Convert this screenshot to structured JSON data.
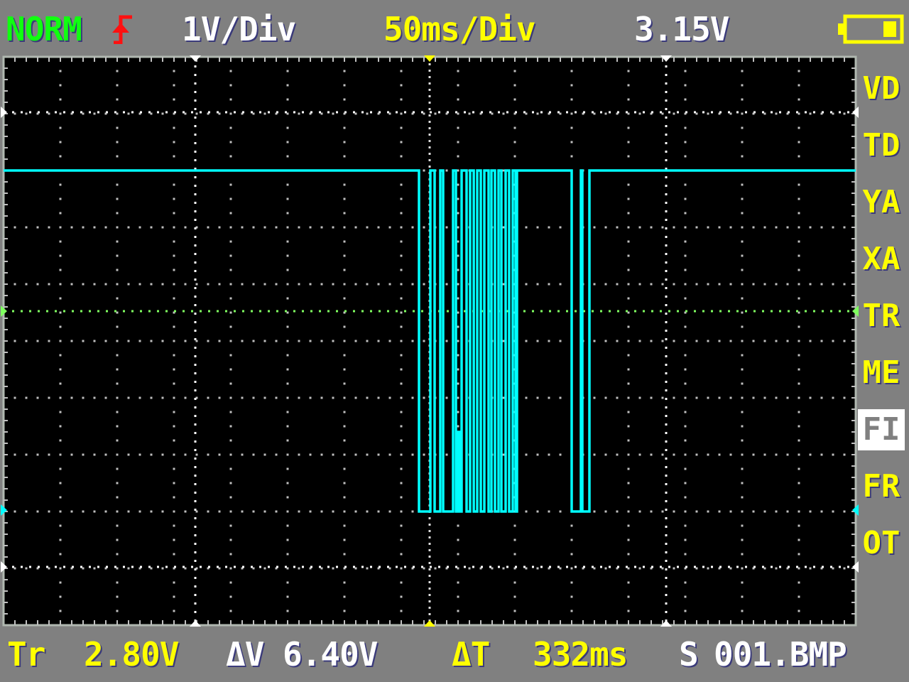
{
  "header": {
    "mode": "NORM",
    "trigger_edge_icon": "rising-edge-icon",
    "volts_per_div": "1V/Div",
    "time_per_div": "50ms/Div",
    "measured_voltage": "3.15V",
    "battery_icon": "battery-icon"
  },
  "menu": [
    {
      "label": "VD",
      "selected": false
    },
    {
      "label": "TD",
      "selected": false
    },
    {
      "label": "YA",
      "selected": false
    },
    {
      "label": "XA",
      "selected": false
    },
    {
      "label": "TR",
      "selected": false
    },
    {
      "label": "ME",
      "selected": false
    },
    {
      "label": "FI",
      "selected": true
    },
    {
      "label": "FR",
      "selected": false
    },
    {
      "label": "OT",
      "selected": false
    }
  ],
  "footer": {
    "trigger_label": "Tr",
    "trigger_value": "2.80V",
    "delta_v_label": "ΔV",
    "delta_v_value": "6.40V",
    "delta_t_label": "ΔT",
    "delta_t_value": "332ms",
    "save_label": "S",
    "save_file": "001.BMP"
  },
  "colors": {
    "trace": "#00ffff",
    "trigger_level": "#80ff60",
    "grid": "#c0c0c0",
    "background": "#808080",
    "screen": "#000000"
  },
  "chart_data": {
    "type": "line",
    "xlabel": "",
    "ylabel": "",
    "x_unit": "ms",
    "y_unit": "V",
    "xlim": [
      -375,
      375
    ],
    "ylim": [
      -2,
      8
    ],
    "grid": true,
    "series": [
      {
        "points": [
          [
            -375,
            6
          ],
          [
            -9.4,
            6
          ],
          [
            -9.4,
            0
          ],
          [
            0.6,
            0
          ],
          [
            0.6,
            6
          ],
          [
            4.4,
            6
          ],
          [
            4.4,
            0
          ],
          [
            9.4,
            0
          ],
          [
            9.4,
            6
          ],
          [
            11.9,
            6
          ],
          [
            11.9,
            0
          ],
          [
            20.6,
            0
          ],
          [
            20.6,
            6
          ],
          [
            23.1,
            6
          ],
          [
            23.1,
            0
          ],
          [
            24,
            0
          ],
          [
            24,
            1.4
          ],
          [
            26,
            1.4
          ],
          [
            26,
            0
          ],
          [
            28.1,
            0
          ],
          [
            28.1,
            6
          ],
          [
            32.5,
            6
          ],
          [
            32.5,
            0
          ],
          [
            35.6,
            0
          ],
          [
            35.6,
            6
          ],
          [
            38.8,
            6
          ],
          [
            38.8,
            0
          ],
          [
            41.9,
            0
          ],
          [
            41.9,
            6
          ],
          [
            45,
            6
          ],
          [
            45,
            0
          ],
          [
            48.1,
            0
          ],
          [
            48.1,
            6
          ],
          [
            51.9,
            6
          ],
          [
            51.9,
            0
          ],
          [
            54.4,
            0
          ],
          [
            54.4,
            6
          ],
          [
            57.5,
            6
          ],
          [
            57.5,
            0
          ],
          [
            60.6,
            0
          ],
          [
            60.6,
            6
          ],
          [
            63.1,
            6
          ],
          [
            63.1,
            0
          ],
          [
            66.9,
            0
          ],
          [
            66.9,
            6
          ],
          [
            70,
            6
          ],
          [
            70,
            0
          ],
          [
            73.1,
            0
          ],
          [
            73.1,
            6
          ],
          [
            75.6,
            6
          ],
          [
            75.6,
            0
          ],
          [
            76.9,
            0
          ],
          [
            76.9,
            6
          ],
          [
            125,
            6
          ],
          [
            125,
            0
          ],
          [
            133.1,
            0
          ],
          [
            133.1,
            6
          ],
          [
            134.4,
            6
          ],
          [
            134.4,
            0
          ],
          [
            140.6,
            0
          ],
          [
            140.6,
            6
          ],
          [
            375,
            6
          ]
        ]
      }
    ]
  }
}
